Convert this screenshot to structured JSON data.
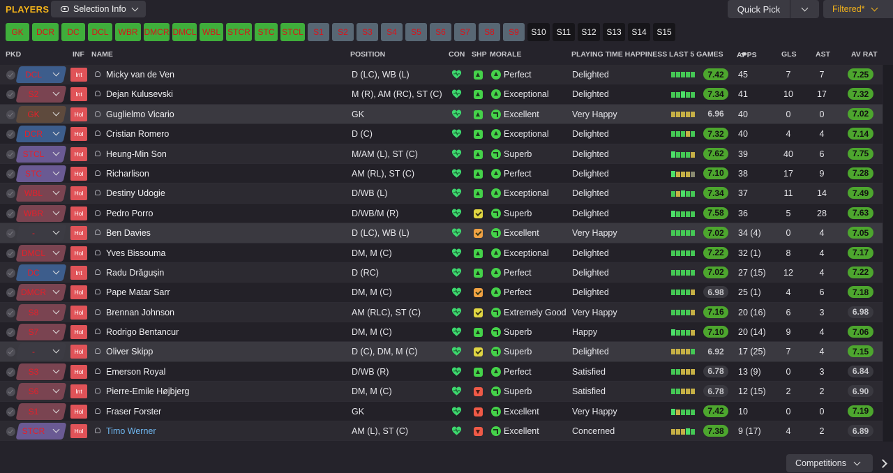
{
  "header": {
    "title": "PLAYERS",
    "selection_info": "Selection Info",
    "quick_pick": "Quick Pick",
    "filtered": "Filtered*"
  },
  "chips": [
    {
      "label": "GK",
      "style": "green",
      "w": 34
    },
    {
      "label": "DCR",
      "style": "green",
      "w": 38
    },
    {
      "label": "DC",
      "style": "green",
      "w": 34
    },
    {
      "label": "DCL",
      "style": "green",
      "w": 35
    },
    {
      "label": "WBR",
      "style": "green",
      "w": 37
    },
    {
      "label": "DMCR",
      "style": "green",
      "w": 37
    },
    {
      "label": "DMCL",
      "style": "green",
      "w": 35
    },
    {
      "label": "WBL",
      "style": "green",
      "w": 34
    },
    {
      "label": "STCR",
      "style": "green",
      "w": 37
    },
    {
      "label": "STC",
      "style": "green",
      "w": 33
    },
    {
      "label": "STCL",
      "style": "green",
      "w": 35
    },
    {
      "label": "S1",
      "style": "gray",
      "w": 31
    },
    {
      "label": "S2",
      "style": "gray",
      "w": 31
    },
    {
      "label": "S3",
      "style": "gray",
      "w": 31
    },
    {
      "label": "S4",
      "style": "gray",
      "w": 31
    },
    {
      "label": "S5",
      "style": "gray",
      "w": 31
    },
    {
      "label": "S6",
      "style": "gray",
      "w": 31
    },
    {
      "label": "S7",
      "style": "gray",
      "w": 31
    },
    {
      "label": "S8",
      "style": "gray",
      "w": 31
    },
    {
      "label": "S9",
      "style": "gray",
      "w": 31
    },
    {
      "label": "S10",
      "style": "dark",
      "w": 32
    },
    {
      "label": "S11",
      "style": "dark",
      "w": 32
    },
    {
      "label": "S12",
      "style": "dark",
      "w": 32
    },
    {
      "label": "S13",
      "style": "dark",
      "w": 32
    },
    {
      "label": "S14",
      "style": "dark",
      "w": 32
    },
    {
      "label": "S15",
      "style": "dark",
      "w": 32
    }
  ],
  "columns": {
    "pkd": "PKD",
    "inf": "INF",
    "name": "NAME",
    "position": "POSITION",
    "con": "CON",
    "shp": "SHP",
    "morale": "MORALE",
    "pth": "PLAYING TIME HAPPINESS",
    "last5": "LAST 5 GAMES",
    "apps": "APPS",
    "gls": "GLS",
    "ast": "AST",
    "avrat": "AV RAT"
  },
  "players": [
    {
      "pos": "DCL",
      "pc": "blue",
      "inf": "Int",
      "name": "Micky van de Ven",
      "position": "D (LC), WB (L)",
      "shp": "g",
      "mi": "full",
      "morale": "Perfect",
      "pth": "Delighted",
      "bars": "ggggg",
      "l5": "7.42",
      "l5c": "g",
      "apps": "45",
      "gls": "7",
      "ast": "7",
      "avrat": "7.25",
      "ac": "g",
      "hl": false
    },
    {
      "pos": "S2",
      "pc": "red",
      "inf": "Int",
      "name": "Dejan Kulusevski",
      "position": "M (R), AM (RC), ST (C)",
      "shp": "g",
      "mi": "full",
      "morale": "Exceptional",
      "pth": "Delighted",
      "bars": "ggGgg",
      "l5": "7.34",
      "l5c": "g",
      "apps": "41",
      "gls": "10",
      "ast": "17",
      "avrat": "7.32",
      "ac": "g",
      "hl": false
    },
    {
      "pos": "GK",
      "pc": "brown",
      "inf": "Hol",
      "name": "Guglielmo Vicario",
      "position": "GK",
      "shp": "g",
      "mi": "half",
      "morale": "Excellent",
      "pth": "Very Happy",
      "bars": "yyyyy",
      "l5": "6.96",
      "l5c": "d",
      "apps": "40",
      "gls": "0",
      "ast": "0",
      "avrat": "7.02",
      "ac": "g",
      "hl": true
    },
    {
      "pos": "DCR",
      "pc": "blue",
      "inf": "Hol",
      "name": "Cristian Romero",
      "position": "D (C)",
      "shp": "g",
      "mi": "full",
      "morale": "Exceptional",
      "pth": "Delighted",
      "bars": "gggyg",
      "l5": "7.32",
      "l5c": "g",
      "apps": "40",
      "gls": "4",
      "ast": "4",
      "avrat": "7.14",
      "ac": "g",
      "hl": false
    },
    {
      "pos": "STCL",
      "pc": "purple",
      "inf": "Hol",
      "name": "Heung-Min Son",
      "position": "M/AM (L), ST (C)",
      "shp": "g",
      "mi": "half",
      "morale": "Superb",
      "pth": "Delighted",
      "bars": "Ggggy",
      "l5": "7.62",
      "l5c": "g",
      "apps": "39",
      "gls": "40",
      "ast": "6",
      "avrat": "7.75",
      "ac": "g",
      "hl": false
    },
    {
      "pos": "STC",
      "pc": "purple",
      "inf": "Hol",
      "name": "Richarlison",
      "position": "AM (RL), ST (C)",
      "shp": "g",
      "mi": "full",
      "morale": "Perfect",
      "pth": "Delighted",
      "bars": "Gyyyx",
      "l5": "7.10",
      "l5c": "g",
      "apps": "38",
      "gls": "17",
      "ast": "9",
      "avrat": "7.28",
      "ac": "g",
      "hl": false
    },
    {
      "pos": "WBL",
      "pc": "red",
      "inf": "Hol",
      "name": "Destiny Udogie",
      "position": "D/WB (L)",
      "shp": "g",
      "mi": "full",
      "morale": "Exceptional",
      "pth": "Delighted",
      "bars": "gyGgg",
      "l5": "7.34",
      "l5c": "g",
      "apps": "37",
      "gls": "11",
      "ast": "14",
      "avrat": "7.49",
      "ac": "g",
      "hl": false
    },
    {
      "pos": "WBR",
      "pc": "red",
      "inf": "Hol",
      "name": "Pedro Porro",
      "position": "D/WB/M (R)",
      "shp": "y",
      "mi": "half",
      "morale": "Superb",
      "pth": "Delighted",
      "bars": "Ggggg",
      "l5": "7.58",
      "l5c": "g",
      "apps": "36",
      "gls": "5",
      "ast": "28",
      "avrat": "7.63",
      "ac": "g",
      "hl": false
    },
    {
      "pos": "-",
      "pc": "none",
      "inf": "Hol",
      "name": "Ben Davies",
      "position": "D (LC), WB (L)",
      "shp": "o",
      "mi": "half",
      "morale": "Excellent",
      "pth": "Very Happy",
      "bars": "ggggg",
      "l5": "7.02",
      "l5c": "g",
      "apps": "34 (4)",
      "gls": "0",
      "ast": "4",
      "avrat": "7.05",
      "ac": "g",
      "hl": true
    },
    {
      "pos": "DMCL",
      "pc": "red",
      "inf": "Hol",
      "name": "Yves Bissouma",
      "position": "DM, M (C)",
      "shp": "g",
      "mi": "full",
      "morale": "Exceptional",
      "pth": "Delighted",
      "bars": "ggggg",
      "l5": "7.22",
      "l5c": "g",
      "apps": "32 (1)",
      "gls": "8",
      "ast": "4",
      "avrat": "7.17",
      "ac": "g",
      "hl": false
    },
    {
      "pos": "DC",
      "pc": "blue",
      "inf": "Int",
      "name": "Radu Drăgușin",
      "position": "D (RC)",
      "shp": "g",
      "mi": "full",
      "morale": "Perfect",
      "pth": "Delighted",
      "bars": "ggggg",
      "l5": "7.02",
      "l5c": "g",
      "apps": "27 (15)",
      "gls": "12",
      "ast": "4",
      "avrat": "7.22",
      "ac": "g",
      "hl": false
    },
    {
      "pos": "DMCR",
      "pc": "red",
      "inf": "Hol",
      "name": "Pape Matar Sarr",
      "position": "DM, M (C)",
      "shp": "o",
      "mi": "full",
      "morale": "Perfect",
      "pth": "Delighted",
      "bars": "ggggy",
      "l5": "6.98",
      "l5c": "d",
      "apps": "25 (1)",
      "gls": "4",
      "ast": "6",
      "avrat": "7.18",
      "ac": "g",
      "hl": false
    },
    {
      "pos": "S8",
      "pc": "red",
      "inf": "Hol",
      "name": "Brennan Johnson",
      "position": "AM (RLC), ST (C)",
      "shp": "y",
      "mi": "half",
      "morale": "Extremely Good",
      "pth": "Very Happy",
      "bars": "ggggy",
      "l5": "7.16",
      "l5c": "g",
      "apps": "20 (16)",
      "gls": "6",
      "ast": "3",
      "avrat": "6.98",
      "ac": "d",
      "hl": false
    },
    {
      "pos": "S7",
      "pc": "red",
      "inf": "Hol",
      "name": "Rodrigo Bentancur",
      "position": "DM, M (C)",
      "shp": "g",
      "mi": "half",
      "morale": "Superb",
      "pth": "Happy",
      "bars": "Ggggy",
      "l5": "7.10",
      "l5c": "g",
      "apps": "20 (14)",
      "gls": "9",
      "ast": "4",
      "avrat": "7.06",
      "ac": "g",
      "hl": false
    },
    {
      "pos": "-",
      "pc": "none",
      "inf": "Hol",
      "name": "Oliver Skipp",
      "position": "D (C), DM, M (C)",
      "shp": "y",
      "mi": "half",
      "morale": "Superb",
      "pth": "Delighted",
      "bars": "yyyyg",
      "l5": "6.92",
      "l5c": "d",
      "apps": "17 (25)",
      "gls": "7",
      "ast": "4",
      "avrat": "7.15",
      "ac": "g",
      "hl": true
    },
    {
      "pos": "S3",
      "pc": "red",
      "inf": "Hol",
      "name": "Emerson Royal",
      "position": "D/WB (R)",
      "shp": "g",
      "mi": "full",
      "morale": "Perfect",
      "pth": "Satisfied",
      "bars": "ggyyy",
      "l5": "6.78",
      "l5c": "d",
      "apps": "13 (9)",
      "gls": "0",
      "ast": "3",
      "avrat": "6.84",
      "ac": "d",
      "hl": false
    },
    {
      "pos": "S6",
      "pc": "red",
      "inf": "Int",
      "name": "Pierre-Emile Højbjerg",
      "position": "DM, M (C)",
      "shp": "r",
      "mi": "half",
      "morale": "Superb",
      "pth": "Satisfied",
      "bars": "ggyyy",
      "l5": "6.78",
      "l5c": "d",
      "apps": "12 (15)",
      "gls": "2",
      "ast": "2",
      "avrat": "6.90",
      "ac": "d",
      "hl": false
    },
    {
      "pos": "S1",
      "pc": "red",
      "inf": "Hol",
      "name": "Fraser Forster",
      "position": "GK",
      "shp": "r",
      "mi": "half",
      "morale": "Excellent",
      "pth": "Very Happy",
      "bars": "Gyggg",
      "l5": "7.42",
      "l5c": "g",
      "apps": "10",
      "gls": "0",
      "ast": "0",
      "avrat": "7.19",
      "ac": "g",
      "hl": false
    },
    {
      "pos": "STCR",
      "pc": "purple",
      "inf": "Hol",
      "name": "Timo Werner",
      "position": "AM (L), ST (C)",
      "shp": "r",
      "mi": "half",
      "morale": "Excellent",
      "pth": "Concerned",
      "bars": "yyyGg",
      "l5": "7.38",
      "l5c": "g",
      "apps": "9 (17)",
      "gls": "4",
      "ast": "2",
      "avrat": "6.89",
      "ac": "d",
      "hl": false,
      "link": true
    }
  ],
  "footer": {
    "competitions": "Competitions"
  }
}
